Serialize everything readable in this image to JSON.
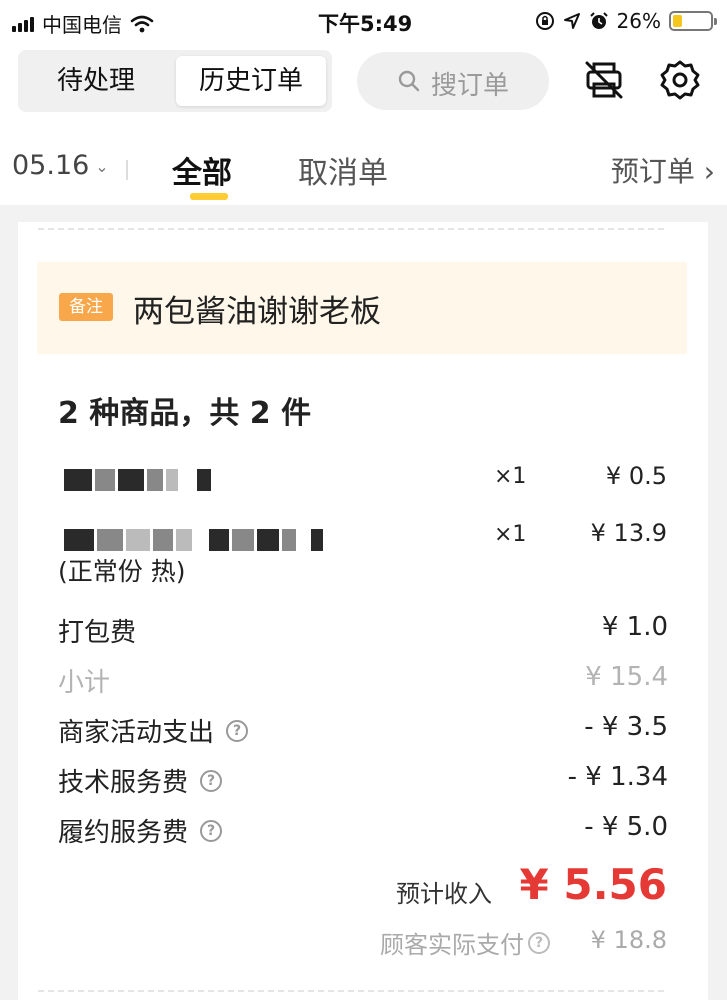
{
  "status_bar": {
    "carrier": "中国电信",
    "time": "下午5:49",
    "battery": "26%",
    "battery_level": 0.26
  },
  "header": {
    "tab_pending": "待处理",
    "tab_history": "历史订单",
    "search_placeholder": "搜订单"
  },
  "tabs": {
    "date": "05.16",
    "all": "全部",
    "cancelled": "取消单",
    "reserve": "预订单"
  },
  "order": {
    "note_tag": "备注",
    "note": "两包酱油谢谢老板",
    "summary": "2 种商品，共 2 件",
    "items": [
      {
        "qty": "×1",
        "price": "¥ 0.5"
      },
      {
        "qty": "×1",
        "price": "¥ 13.9",
        "spec": "(正常份 热)"
      }
    ],
    "fees": [
      {
        "label": "打包费",
        "value": "¥ 1.0"
      },
      {
        "label": "小计",
        "value": "¥ 15.4"
      },
      {
        "label": "商家活动支出",
        "value": "- ¥ 3.5"
      },
      {
        "label": "技术服务费",
        "value": "- ¥ 1.34"
      },
      {
        "label": "履约服务费",
        "value": "- ¥ 5.0"
      }
    ],
    "income_label": "预计收入",
    "income_value": "¥ 5.56",
    "paid_label": "顾客实际支付",
    "paid_value": "¥ 18.8"
  },
  "colors": {
    "accent_yellow": "#ffcc33",
    "note_tag": "#f8a84a",
    "income_red": "#e53935"
  },
  "icons": [
    "wifi-icon",
    "rotation-lock-icon",
    "location-arrow-icon",
    "alarm-icon",
    "battery-icon",
    "search-icon",
    "printer-off-icon",
    "gear-icon",
    "chevron-down-icon",
    "chevron-right-icon",
    "question-icon"
  ]
}
